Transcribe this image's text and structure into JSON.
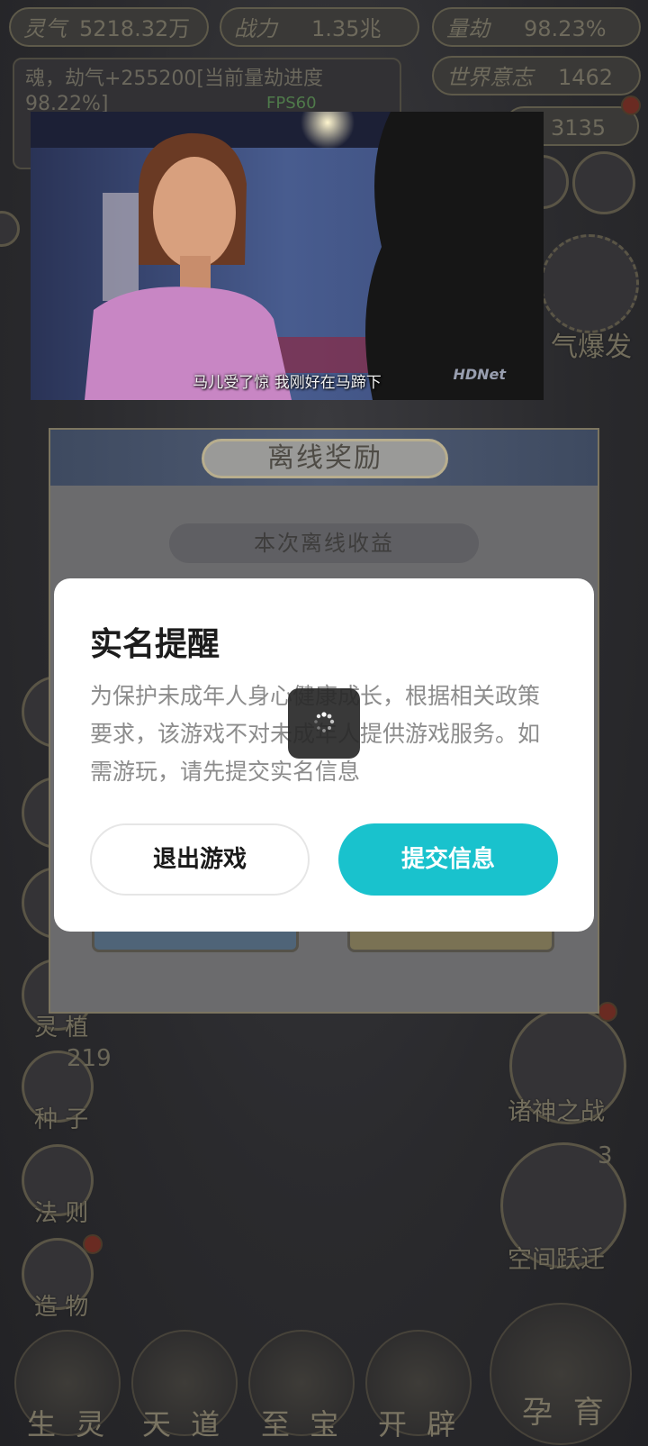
{
  "hud": {
    "stats": [
      {
        "label": "灵气",
        "value": "5218.32万"
      },
      {
        "label": "战力",
        "value": "1.35兆"
      },
      {
        "label": "量劫",
        "value": "98.23%"
      }
    ],
    "world_will": {
      "label": "世界意志",
      "value": "1462"
    },
    "log_text": "魂，劫气+255200[当前量劫进度98.22%]",
    "fps": "FPS60",
    "counter_partial": "3135",
    "burst_label": "气爆发"
  },
  "left_menu": [
    {
      "label": "灵 植"
    },
    {
      "label": "种 子",
      "count": "219"
    },
    {
      "label": "法 则"
    },
    {
      "label": "造 物"
    }
  ],
  "right_menu": [
    {
      "label": "诸神之战"
    },
    {
      "label": "空间跃迁",
      "count": "3"
    }
  ],
  "bottom_nav": [
    {
      "label": "生 灵"
    },
    {
      "label": "天 道"
    },
    {
      "label": "至 宝"
    },
    {
      "label": "开 辟"
    },
    {
      "label": "孕 育"
    }
  ],
  "video": {
    "subtitle": "马儿受了惊 我刚好在马蹄下",
    "watermark": "HDNet"
  },
  "offline_panel": {
    "title": "离线奖励",
    "subtitle": "本次离线收益"
  },
  "dialog": {
    "title": "实名提醒",
    "body": "为保护未成年人身心健康成长，根据相关政策要求，该游戏不对未成年人提供游戏服务。如需游玩，请先提交实名信息",
    "exit_label": "退出游戏",
    "submit_label": "提交信息",
    "submit_color": "#19c2cd"
  }
}
